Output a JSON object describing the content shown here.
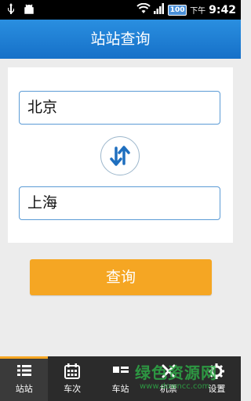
{
  "status_bar": {
    "battery": "100",
    "ampm": "下午",
    "time": "9:42"
  },
  "header": {
    "title": "站站查询"
  },
  "search": {
    "from_station": "北京",
    "to_station": "上海",
    "swap_icon": "swap-vertical-arrows-icon",
    "query_label": "查询"
  },
  "bottom_nav": {
    "items": [
      {
        "label": "站站",
        "icon": "list-icon",
        "active": true
      },
      {
        "label": "车次",
        "icon": "calendar-grid-icon",
        "active": false
      },
      {
        "label": "车站",
        "icon": "station-list-icon",
        "active": false
      },
      {
        "label": "机票",
        "icon": "close-x-icon",
        "active": false
      },
      {
        "label": "设置",
        "icon": "gear-icon",
        "active": false
      }
    ]
  },
  "watermark": {
    "text": "绿色资源网",
    "url": "www.downcc.com"
  },
  "colors": {
    "header": "#1f7fd6",
    "button": "#f5a623",
    "field_border": "#5b9bd5",
    "nav_bg": "#2b2b2b"
  }
}
